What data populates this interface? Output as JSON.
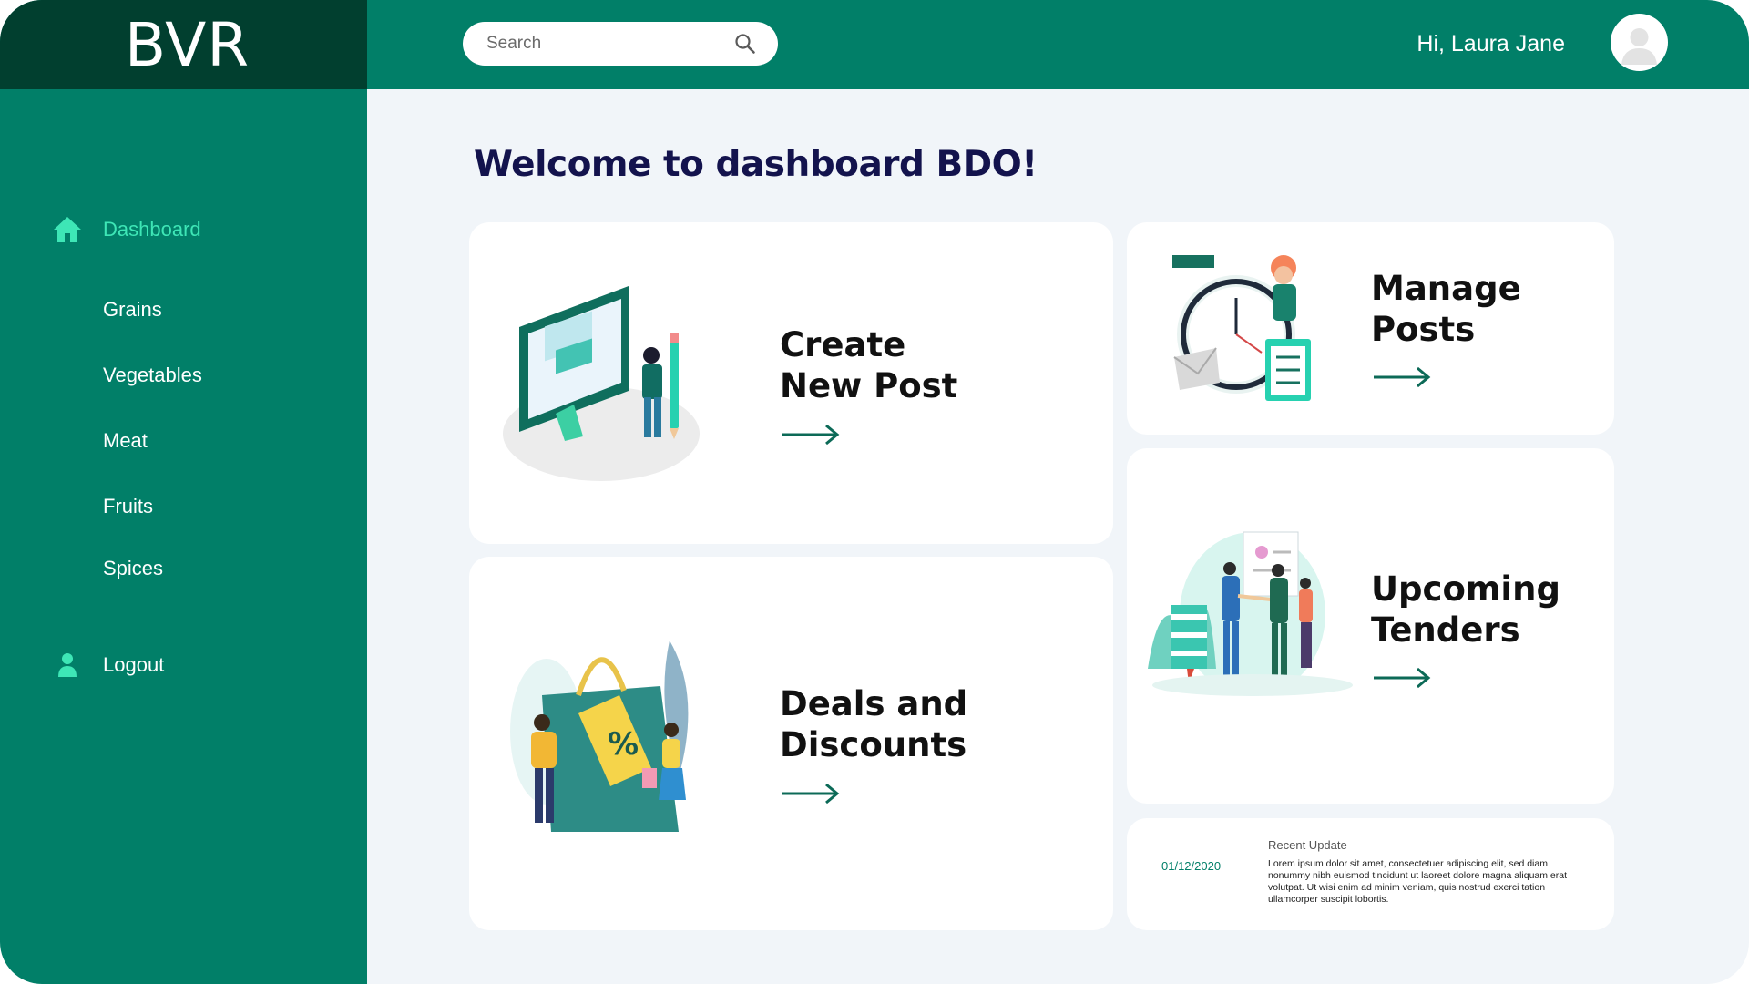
{
  "app": {
    "brand": "BVR"
  },
  "sidebar": {
    "items": [
      {
        "label": "Dashboard",
        "icon": "home-icon",
        "active": true
      },
      {
        "label": "Grains"
      },
      {
        "label": "Vegetables"
      },
      {
        "label": "Meat"
      },
      {
        "label": "Fruits"
      },
      {
        "label": "Spices"
      },
      {
        "label": "Logout",
        "icon": "user-icon"
      }
    ]
  },
  "header": {
    "search_placeholder": "Search",
    "greeting": "Hi, Laura Jane"
  },
  "main": {
    "title": "Welcome to dashboard BDO!",
    "cards": {
      "create": {
        "title": "Create\nNew Post"
      },
      "manage": {
        "title": "Manage\nPosts"
      },
      "deals": {
        "title": "Deals and\nDiscounts"
      },
      "tenders": {
        "title": "Upcoming\nTenders"
      }
    },
    "recent_update": {
      "heading": "Recent Update",
      "date": "01/12/2020",
      "text": "Lorem ipsum dolor sit amet, consectetuer adipiscing elit, sed diam nonummy nibh euismod tincidunt ut laoreet dolore magna aliquam erat volutpat. Ut wisi enim ad minim veniam, quis nostrud exerci tation ullamcorper suscipit lobortis."
    }
  },
  "colors": {
    "primary": "#017f68",
    "logo_bg": "#013f2f",
    "active": "#3ee6b6",
    "title": "#13134d",
    "background": "#f1f5f9"
  }
}
